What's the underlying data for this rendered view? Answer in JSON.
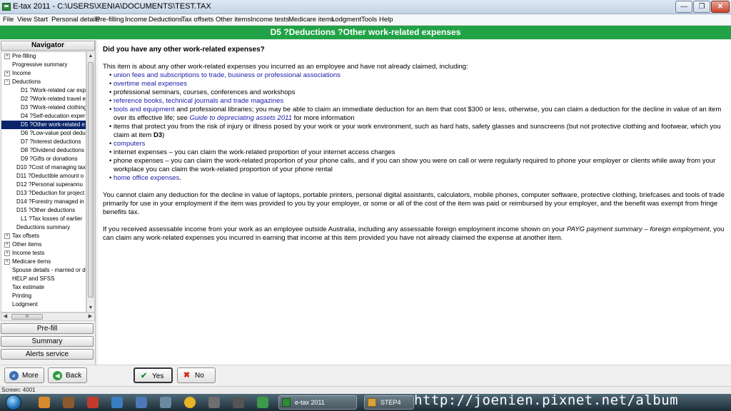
{
  "window": {
    "title": "E-tax 2011 - C:\\USERS\\XENIA\\DOCUMENTS\\TEST.TAX",
    "minimize_glyph": "—",
    "maximize_glyph": "❐",
    "close_glyph": "✕"
  },
  "menu": {
    "items": [
      "File",
      "View",
      "Start",
      "Personal details",
      "Pre-filling",
      "Income",
      "Deductions",
      "Tax offsets",
      "Other items",
      "Income tests",
      "Medicare items",
      "Lodgment",
      "Tools",
      "Help"
    ]
  },
  "header": {
    "title": "D5 ?Deductions ?Other work-related expenses",
    "background_color": "#22a246"
  },
  "navigator": {
    "title": "Navigator",
    "items": [
      {
        "label": "Pre-filling",
        "expander": "+"
      },
      {
        "label": "Progressive summary",
        "expander": ""
      },
      {
        "label": "Income",
        "expander": "+"
      },
      {
        "label": "Deductions",
        "expander": "−"
      },
      {
        "label": "D1 ?Work-related car exp",
        "expander": ""
      },
      {
        "label": "D2 ?Work-related travel e",
        "expander": ""
      },
      {
        "label": "D3 ?Work-related clothing",
        "expander": ""
      },
      {
        "label": "D4 ?Self-education exper",
        "expander": ""
      },
      {
        "label": "D5 ?Other work-related e",
        "expander": ""
      },
      {
        "label": "D6 ?Low-value pool dedu",
        "expander": ""
      },
      {
        "label": "D7 ?Interest deductions",
        "expander": ""
      },
      {
        "label": "D8 ?Dividend deductions",
        "expander": ""
      },
      {
        "label": "D9 ?Gifts or donations",
        "expander": ""
      },
      {
        "label": "D10 ?Cost of managing tax",
        "expander": ""
      },
      {
        "label": "D11 ?Deductible amount o",
        "expander": ""
      },
      {
        "label": "D12 ?Personal superannu",
        "expander": ""
      },
      {
        "label": "D13 ?Deduction for project",
        "expander": ""
      },
      {
        "label": "D14 ?Forestry managed in",
        "expander": ""
      },
      {
        "label": "D15 ?Other deductions",
        "expander": ""
      },
      {
        "label": "L1 ?Tax losses of earlier",
        "expander": ""
      },
      {
        "label": "Deductions summary",
        "expander": ""
      },
      {
        "label": "Tax offsets",
        "expander": "+"
      },
      {
        "label": "Other items",
        "expander": "+"
      },
      {
        "label": "Income tests",
        "expander": "+"
      },
      {
        "label": "Medicare items",
        "expander": "+"
      },
      {
        "label": "Spouse details - married or d",
        "expander": ""
      },
      {
        "label": "HELP and SFSS",
        "expander": ""
      },
      {
        "label": "Tax estimate",
        "expander": ""
      },
      {
        "label": "Printing",
        "expander": ""
      },
      {
        "label": "Lodgment",
        "expander": ""
      }
    ],
    "selected_index": 8,
    "scroll_up_glyph": "▲",
    "scroll_down_glyph": "▼",
    "scroll_left_glyph": "◀",
    "scroll_right_glyph": "▶",
    "hscroll_grip": "III",
    "buttons": [
      "Pre-fill",
      "Summary",
      "Alerts service"
    ]
  },
  "content": {
    "question": "Did you have any other work-related expenses?",
    "intro": "This item is about any other work-related expenses you incurred as an employee and have not already claimed, including:",
    "bullets": [
      {
        "link": "union fees and subscriptions to trade, business or professional associations",
        "text": ""
      },
      {
        "link": "overtime meal expenses",
        "text": ""
      },
      {
        "link": "",
        "text": "professional seminars, courses, conferences and workshops"
      },
      {
        "link": "reference books, technical journals and trade magazines",
        "text": ""
      },
      {
        "link": "tools and equipment",
        "text": " and professional libraries; you may be able to claim an immediate deduction for an item that cost $300 or less, otherwise, you can claim a deduction for the decline in value of an item over its effective life; see ",
        "italic_link": "Guide to depreciating assets 2011",
        "tail": " for more information"
      },
      {
        "link": "",
        "text": "items that protect you from the risk of injury or illness posed by your work or your work environment, such as hard hats, safety glasses and sunscreens (but not protective clothing and footwear, which you claim at item ",
        "bold_tail": "D3",
        "tail": ")"
      },
      {
        "link": "computers",
        "text": ""
      },
      {
        "link": "",
        "text": "internet expenses – you can claim the work-related proportion of your internet access charges"
      },
      {
        "link": "",
        "text": "phone expenses – you can claim the work-related proportion of your phone calls, and if you can show you were on call or were regularly required to phone your employer or clients while away from your workplace you can claim the work-related proportion of your phone rental"
      },
      {
        "link": "home office expenses",
        "text": "."
      }
    ],
    "para_laptops": "You cannot claim any deduction for the decline in value of laptops, portable printers, personal digital assistants, calculators, mobile phones, computer software, protective clothing, briefcases and tools of trade primarily for use in your employment if the item was provided to you by your employer, or some or all of the cost of the item was paid or reimbursed by your employer, and the benefit was exempt from fringe benefits tax.",
    "para_foreign_1": "If you received assessable income from your work as an employee outside Australia, including any assessable foreign employment income shown on your ",
    "para_foreign_italic": "PAYG payment summary – foreign employment",
    "para_foreign_2": ", you can claim any work-related expenses you incurred in earning that income at this item provided you have not already claimed the expense at another item.",
    "link_color": "#1b1ba8"
  },
  "bottom_buttons": {
    "more": {
      "label": "More",
      "icon": "search-icon"
    },
    "back": {
      "label": "Back",
      "icon": "back-arrow-icon"
    },
    "yes": {
      "label": "Yes",
      "icon": "check-icon"
    },
    "no": {
      "label": "No",
      "icon": "x-icon"
    }
  },
  "status": {
    "text": "Screen: 4001"
  },
  "taskbar": {
    "tasks": [
      "e-tax 2011",
      "STEP4"
    ]
  },
  "watermark": "http://joenien.pixnet.net/album"
}
